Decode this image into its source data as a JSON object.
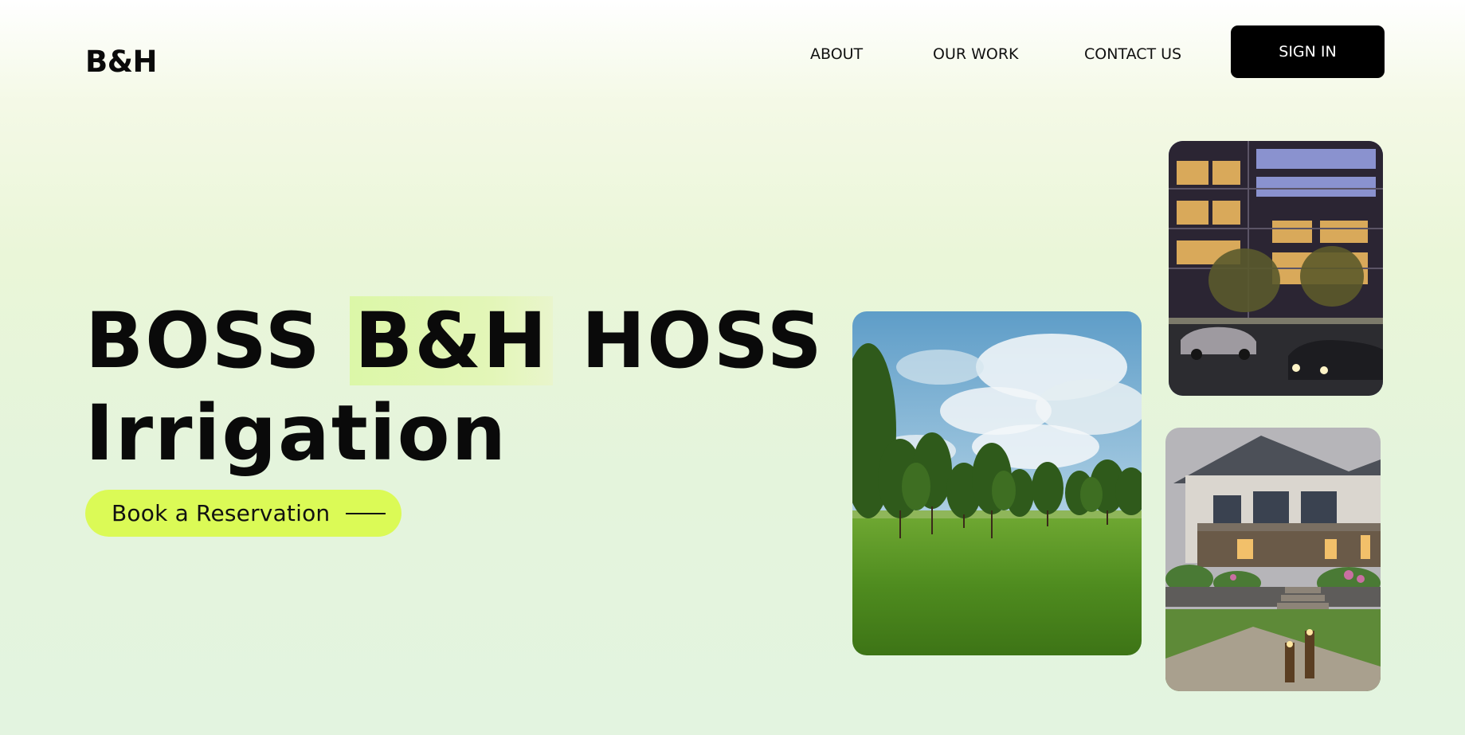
{
  "header": {
    "logo": "B&H",
    "nav": [
      {
        "label": "ABOUT"
      },
      {
        "label": "OUR WORK"
      },
      {
        "label": "CONTACT US"
      }
    ],
    "sign_in": "SIGN IN"
  },
  "hero": {
    "title_word1": "BOSS",
    "title_highlight": "B&H",
    "title_word3": "HOSS",
    "title_line2": "Irrigation",
    "cta_label": "Book a Reservation"
  },
  "colors": {
    "accent": "#dbfa56",
    "highlight": "#dcf7a8",
    "button_bg": "#000000",
    "text": "#0a0a0a"
  },
  "images": [
    {
      "name": "lawn-with-trees-photo"
    },
    {
      "name": "apartment-building-night-photo"
    },
    {
      "name": "house-backyard-evening-photo"
    }
  ]
}
